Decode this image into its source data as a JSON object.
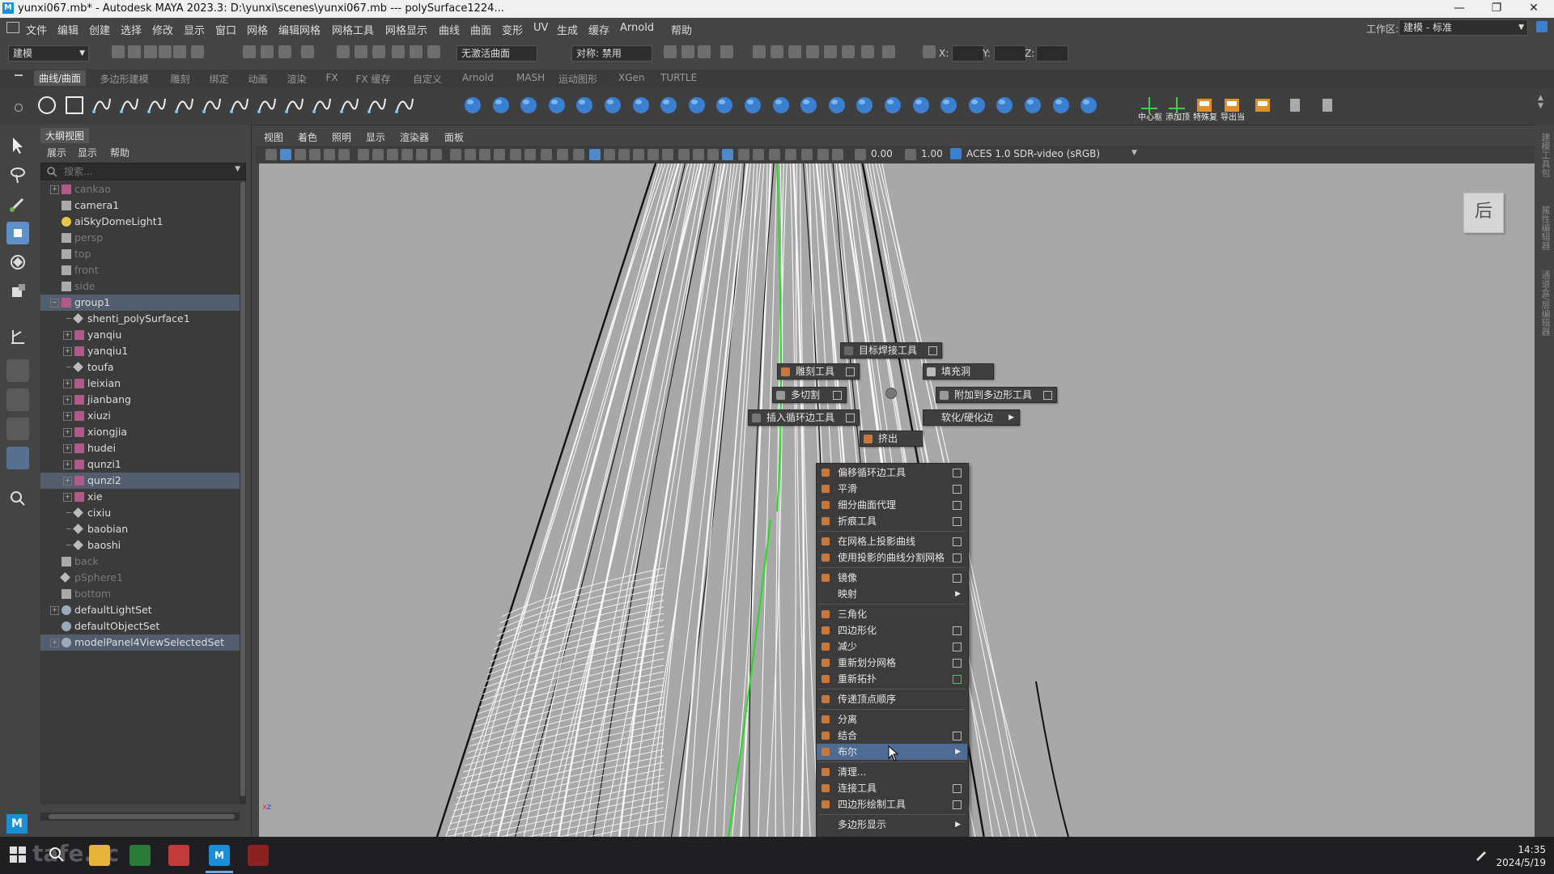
{
  "window": {
    "title": "yunxi067.mb* - Autodesk MAYA 2023.3: D:\\yunxi\\scenes\\yunxi067.mb  ---  polySurface1224...",
    "app_logo": "M",
    "minimize": "—",
    "maximize": "❐",
    "close": "✕"
  },
  "menubar": {
    "items": [
      "文件",
      "编辑",
      "创建",
      "选择",
      "修改",
      "显示",
      "窗口",
      "网格",
      "编辑网格",
      "网格工具",
      "网格显示",
      "曲线",
      "曲面",
      "变形",
      "UV",
      "生成",
      "缓存",
      "Arnold",
      "帮助"
    ],
    "workspace_label": "工作区:",
    "workspace_value": "建模 - 标准"
  },
  "statusline": {
    "mode": "建模",
    "surface_field": "无激活曲面",
    "symmetry": "对称: 禁用",
    "x_label": "X:",
    "y_label": "Y:",
    "z_label": "Z:"
  },
  "shelf": {
    "tabs": [
      "曲线/曲面",
      "多边形建模",
      "雕刻",
      "绑定",
      "动画",
      "渲染",
      "FX",
      "FX 缓存",
      "自定义",
      "Arnold",
      "MASH",
      "运动图形",
      "XGen",
      "TURTLE"
    ],
    "active_tab": "曲线/曲面",
    "labels": [
      "中心枢",
      "添加顶",
      "特殊复",
      "导出当"
    ]
  },
  "outliner": {
    "title": "大纲视图",
    "menus": [
      "展示",
      "显示",
      "帮助"
    ],
    "search_placeholder": "搜索...",
    "rows": [
      {
        "label": "cankao",
        "dim": true,
        "exp": "+",
        "icon": "group"
      },
      {
        "label": "camera1",
        "icon": "camera"
      },
      {
        "label": "aiSkyDomeLight1",
        "icon": "light"
      },
      {
        "label": "persp",
        "dim": true,
        "icon": "camera"
      },
      {
        "label": "top",
        "dim": true,
        "icon": "camera"
      },
      {
        "label": "front",
        "dim": true,
        "icon": "camera"
      },
      {
        "label": "side",
        "dim": true,
        "icon": "camera"
      },
      {
        "label": "group1",
        "sel": true,
        "exp": "−",
        "icon": "group"
      },
      {
        "label": "shenti_polySurface1",
        "indent": 1,
        "icon": "mesh"
      },
      {
        "label": "yanqiu",
        "indent": 1,
        "exp": "+",
        "icon": "group"
      },
      {
        "label": "yanqiu1",
        "indent": 1,
        "exp": "+",
        "icon": "group"
      },
      {
        "label": "toufa",
        "indent": 1,
        "icon": "mesh"
      },
      {
        "label": "leixian",
        "indent": 1,
        "exp": "+",
        "icon": "group"
      },
      {
        "label": "jianbang",
        "indent": 1,
        "exp": "+",
        "icon": "group"
      },
      {
        "label": "xiuzi",
        "indent": 1,
        "exp": "+",
        "icon": "group"
      },
      {
        "label": "xiongjia",
        "indent": 1,
        "exp": "+",
        "icon": "group"
      },
      {
        "label": "hudei",
        "indent": 1,
        "exp": "+",
        "icon": "group"
      },
      {
        "label": "qunzi1",
        "indent": 1,
        "exp": "+",
        "icon": "group"
      },
      {
        "label": "qunzi2",
        "indent": 1,
        "sel": true,
        "exp": "+",
        "icon": "group"
      },
      {
        "label": "xie",
        "indent": 1,
        "exp": "+",
        "icon": "group"
      },
      {
        "label": "cixiu",
        "indent": 1,
        "icon": "mesh"
      },
      {
        "label": "baobian",
        "indent": 1,
        "icon": "mesh"
      },
      {
        "label": "baoshi",
        "indent": 1,
        "icon": "mesh"
      },
      {
        "label": "back",
        "dim": true,
        "icon": "camera"
      },
      {
        "label": "pSphere1",
        "dim": true,
        "icon": "mesh"
      },
      {
        "label": "bottom",
        "dim": true,
        "icon": "camera"
      },
      {
        "label": "defaultLightSet",
        "exp": "+",
        "icon": "set"
      },
      {
        "label": "defaultObjectSet",
        "icon": "set"
      },
      {
        "label": "modelPanel4ViewSelectedSet",
        "sel": true,
        "exp": "+",
        "icon": "set"
      }
    ]
  },
  "viewport": {
    "menus": [
      "视图",
      "着色",
      "照明",
      "显示",
      "渲染器",
      "面板"
    ],
    "exposure": "0.00",
    "gamma": "1.00",
    "color_space": "ACES 1.0 SDR-video (sRGB)",
    "viewcube_label": "后",
    "axis_x": "x",
    "axis_z": "z"
  },
  "marking_menu": {
    "north": "目标焊接工具",
    "nw1": "雕刻工具",
    "ne1": "填充洞",
    "west": "多切割",
    "east": "附加到多边形工具",
    "sw": "插入循环边工具",
    "se": "软化/硬化边",
    "south": "挤出"
  },
  "context_menu": {
    "items": [
      {
        "label": "偏移循环边工具",
        "box": true
      },
      {
        "label": "平滑",
        "box": true
      },
      {
        "label": "细分曲面代理",
        "box": true
      },
      {
        "label": "折痕工具",
        "box": true
      },
      {
        "sep": true
      },
      {
        "label": "在网格上投影曲线",
        "box": true
      },
      {
        "label": "使用投影的曲线分割网格",
        "box": true
      },
      {
        "sep": true
      },
      {
        "label": "镜像",
        "box": true
      },
      {
        "label": "映射",
        "arrow": true,
        "noicon": true
      },
      {
        "sep": true
      },
      {
        "label": "三角化"
      },
      {
        "label": "四边形化",
        "box": true
      },
      {
        "label": "减少",
        "box": true
      },
      {
        "label": "重新划分网格",
        "box": true
      },
      {
        "label": "重新拓扑",
        "box": true,
        "green": true
      },
      {
        "sep": true
      },
      {
        "label": "传递顶点顺序"
      },
      {
        "sep": true
      },
      {
        "label": "分离"
      },
      {
        "label": "结合",
        "box": true
      },
      {
        "label": "布尔",
        "arrow": true,
        "highlight": true
      },
      {
        "sep": true
      },
      {
        "label": "清理..."
      },
      {
        "label": "连接工具",
        "box": true
      },
      {
        "label": "四边形绘制工具",
        "box": true
      },
      {
        "sep": true
      },
      {
        "label": "多边形显示",
        "arrow": true,
        "noicon": true
      }
    ]
  },
  "right_dock": [
    "建模工具包",
    "属性编辑器",
    "通道盒/层编辑器"
  ],
  "taskbar": {
    "time": "14:35",
    "date": "2024/5/19",
    "watermark": "tafe.cc"
  },
  "colors": {
    "accent_blue": "#4e6b94",
    "icon_orange": "#c8783a",
    "shelf_blue": "#3b7fd1",
    "viewport_bg": "#a8a8a8",
    "wire_green": "#22dd22"
  }
}
